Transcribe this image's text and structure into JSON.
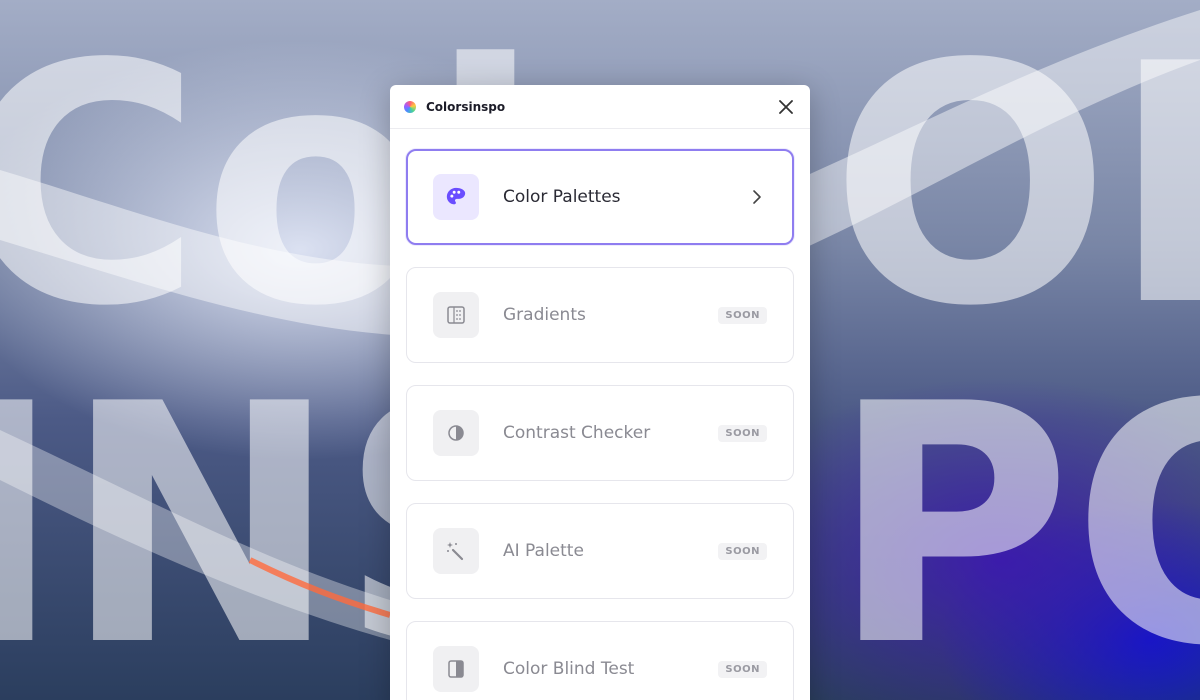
{
  "background": {
    "text_line_1": "Col",
    "text_line_1_right": "OI",
    "text_line_2": "INS",
    "text_line_2_right": "PO"
  },
  "window": {
    "title": "Colorsinspo",
    "close_icon": "close-icon"
  },
  "menu": {
    "items": [
      {
        "label": "Color Palettes",
        "icon": "palette-icon",
        "active": true,
        "badge": ""
      },
      {
        "label": "Gradients",
        "icon": "gradient-icon",
        "active": false,
        "badge": "SOON"
      },
      {
        "label": "Contrast Checker",
        "icon": "contrast-icon",
        "active": false,
        "badge": "SOON"
      },
      {
        "label": "AI Palette",
        "icon": "magic-wand-icon",
        "active": false,
        "badge": "SOON"
      },
      {
        "label": "Color Blind Test",
        "icon": "color-blind-icon",
        "active": false,
        "badge": "SOON"
      }
    ]
  },
  "colors": {
    "accent": "#8f7df0",
    "accent_icon": "#6a4dff",
    "muted_icon": "#9a9aa2"
  }
}
